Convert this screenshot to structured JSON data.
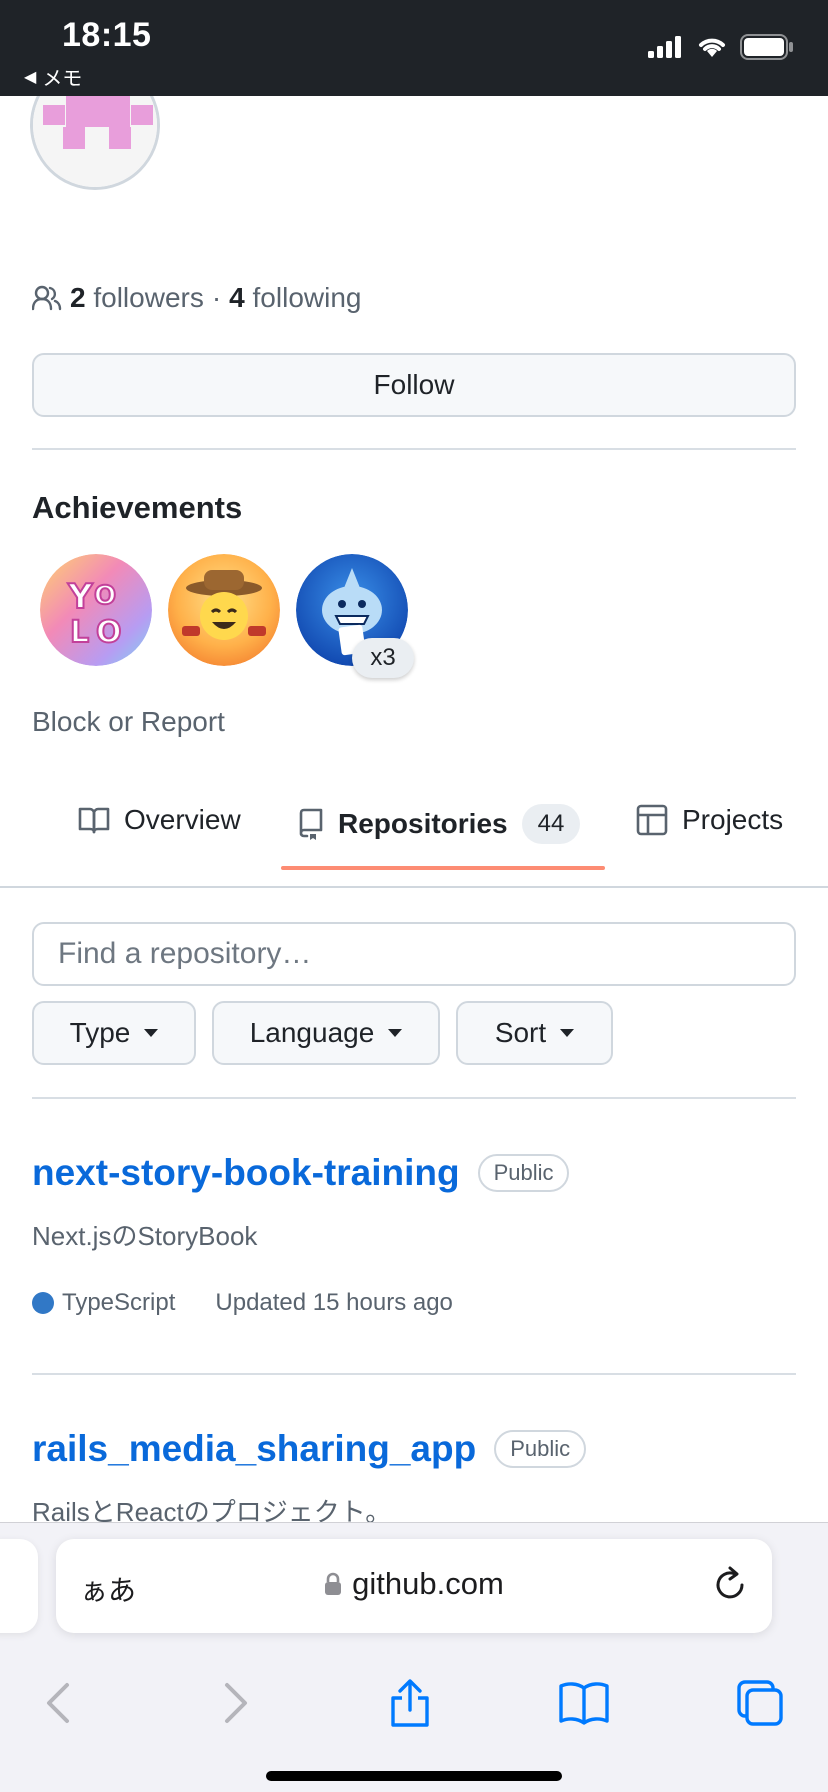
{
  "status_bar": {
    "time": "18:15",
    "back_label": "メモ",
    "back_icon": "triangle-left",
    "signal_icon": "cellular-signal",
    "wifi_icon": "wifi",
    "battery_icon": "battery"
  },
  "profile": {
    "avatar_icon": "identicon-avatar",
    "followers_count": "2",
    "followers_label": "followers",
    "separator": "·",
    "following_count": "4",
    "following_label": "following",
    "follow_button": "Follow",
    "achievements_title": "Achievements",
    "achievements": [
      {
        "icon": "yolo-badge"
      },
      {
        "icon": "quickdraw-badge"
      },
      {
        "icon": "pull-shark-badge",
        "count": "x3"
      }
    ],
    "block_report": "Block or Report"
  },
  "tabs": [
    {
      "label": "Overview",
      "icon": "book-icon"
    },
    {
      "label": "Repositories",
      "icon": "repo-icon",
      "counter": "44",
      "active": true
    },
    {
      "label": "Projects",
      "icon": "table-icon"
    }
  ],
  "search": {
    "placeholder": "Find a repository…",
    "value": ""
  },
  "filters": [
    "Type",
    "Language",
    "Sort"
  ],
  "repos": [
    {
      "name": "next-story-book-training",
      "visibility": "Public",
      "description": "Next.jsのStoryBook",
      "language": "TypeScript",
      "language_color": "#3178c6",
      "updated": "Updated 15 hours ago"
    },
    {
      "name": "rails_media_sharing_app",
      "visibility": "Public",
      "description": "RailsとReactのプロジェクト。"
    }
  ],
  "browser": {
    "aa_label": "ぁあ",
    "url": "github.com",
    "lock_icon": "lock",
    "reload_icon": "reload",
    "toolbar": [
      "back-icon",
      "forward-icon",
      "share-icon",
      "bookmarks-icon",
      "tabs-icon"
    ]
  },
  "colors": {
    "link": "#0969da",
    "tab_underline": "#fd8c73",
    "muted": "#59636e"
  }
}
